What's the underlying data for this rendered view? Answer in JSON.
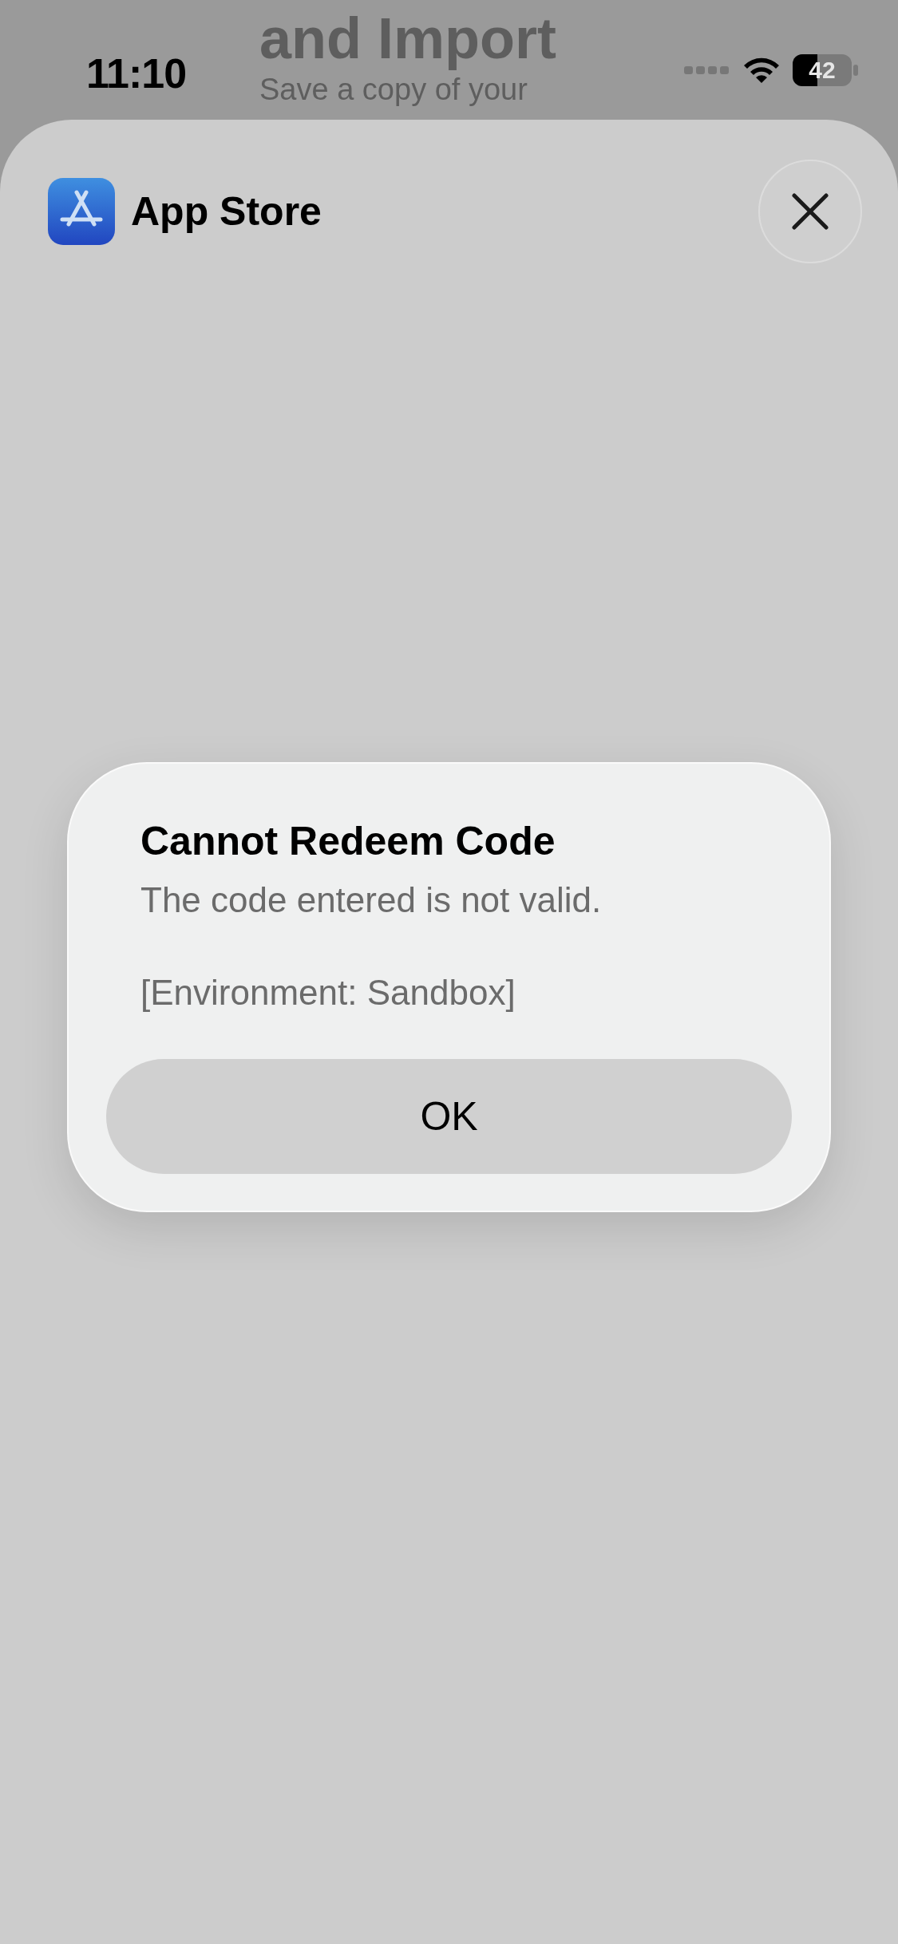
{
  "background": {
    "heading": "and Import",
    "subtitle": "Save a copy of your"
  },
  "status_bar": {
    "time": "11:10",
    "battery": "42"
  },
  "sheet": {
    "app_name": "App Store"
  },
  "alert": {
    "title": "Cannot Redeem Code",
    "message": "The code entered is not valid.",
    "detail": "[Environment: Sandbox]",
    "buttons": [
      "OK"
    ]
  }
}
